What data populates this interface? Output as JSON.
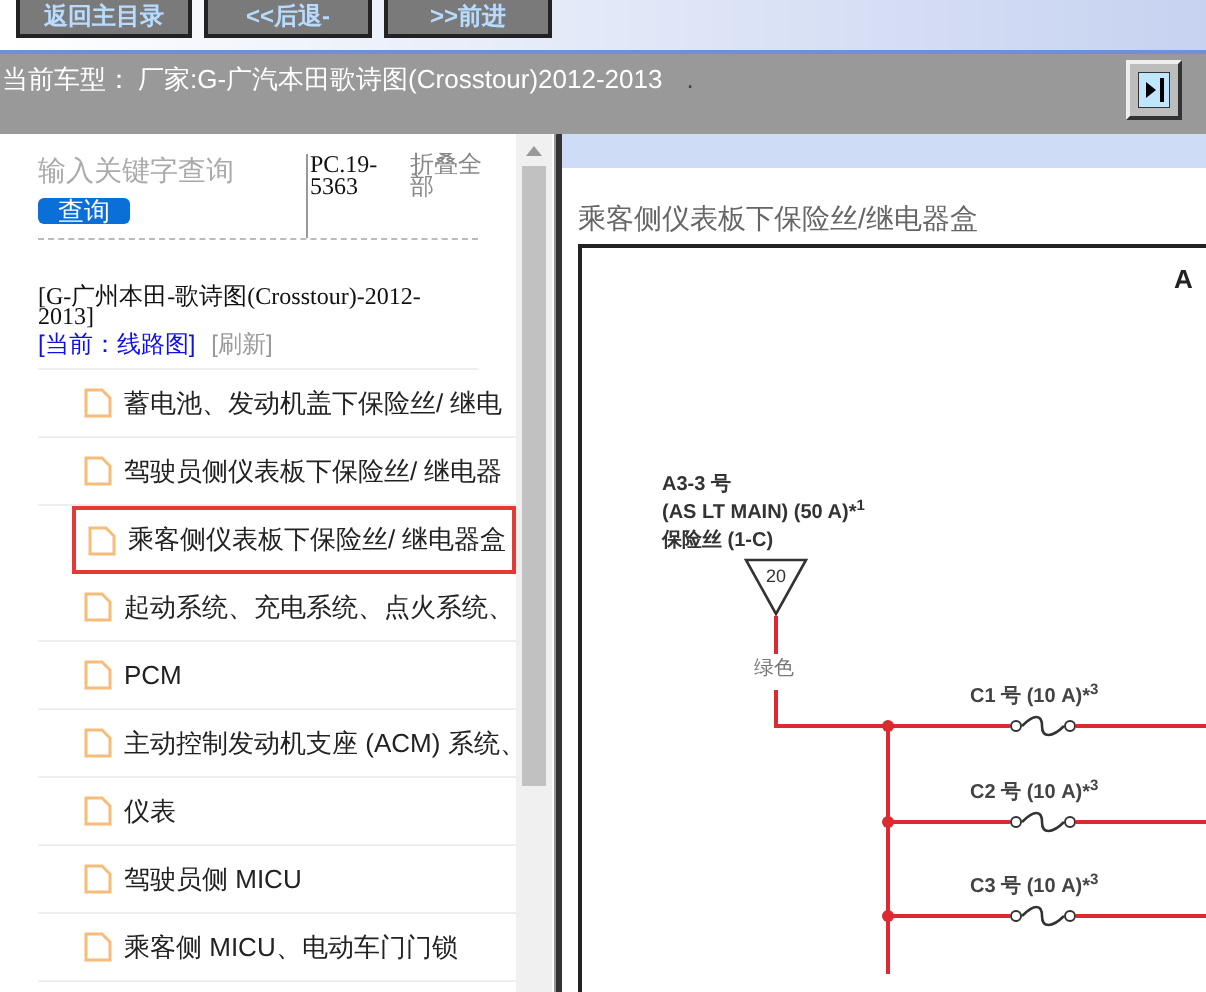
{
  "toolbar": {
    "buttons": [
      "返回主目录",
      "<<后退-",
      ">>前进"
    ]
  },
  "vehicle_bar": {
    "label": "当前车型：",
    "value": "厂家:G-广汽本田歌诗图(Crosstour)2012-2013",
    "mark": "."
  },
  "sidebar": {
    "search": {
      "placeholder": "输入关键字查询",
      "button": "查询"
    },
    "code": "PC.19-5363",
    "collapse_all": "折叠全部",
    "model": "[G-广州本田-歌诗图(Crosstour)-2012-2013]",
    "current": "[当前：线路图]",
    "refresh": "[刷新]",
    "items": [
      {
        "label": "蓄电池、发动机盖下保险丝/ 继电",
        "selected": false
      },
      {
        "label": "驾驶员侧仪表板下保险丝/ 继电器",
        "selected": false
      },
      {
        "label": "乘客侧仪表板下保险丝/ 继电器盒",
        "selected": true
      },
      {
        "label": "起动系统、充电系统、点火系统、",
        "selected": false
      },
      {
        "label": "PCM",
        "selected": false
      },
      {
        "label": "主动控制发动机支座 (ACM) 系统、",
        "selected": false
      },
      {
        "label": "仪表",
        "selected": false
      },
      {
        "label": "驾驶员侧 MICU",
        "selected": false
      },
      {
        "label": "乘客侧 MICU、电动车门门锁",
        "selected": false
      }
    ]
  },
  "diagram": {
    "title": "乘客侧仪表板下保险丝/继电器盒",
    "corner_label": "A",
    "source": [
      "A3-3 号",
      "(AS LT MAIN) (50 A)*$^{1}$",
      "保险丝 (1-C)"
    ],
    "connector": "20",
    "wire_color": "绿色",
    "fuses": [
      {
        "label": "C1 号 (10 A)*$^{3}$"
      },
      {
        "label": "C2 号 (10 A)*$^{3}$"
      },
      {
        "label": "C3 号 (10 A)*$^{3}$"
      }
    ]
  }
}
